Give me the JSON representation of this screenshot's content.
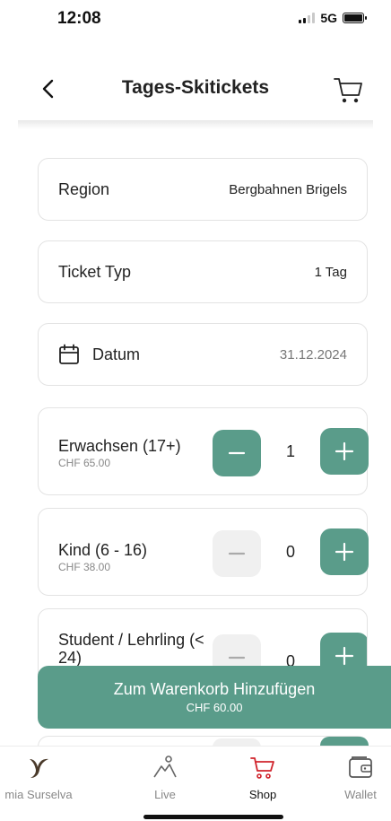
{
  "status_bar": {
    "time": "12:08",
    "network": "5G"
  },
  "header": {
    "title": "Tages-Skitickets"
  },
  "fields": {
    "region": {
      "label": "Region",
      "value": "Bergbahnen Brigels"
    },
    "ticket_type": {
      "label": "Ticket Typ",
      "value": "1 Tag"
    },
    "date": {
      "label": "Datum",
      "value": "31.12.2024"
    }
  },
  "categories": [
    {
      "name": "Erwachsen (17+)",
      "price": "CHF 65.00",
      "quantity": "1",
      "minus_enabled": true
    },
    {
      "name": "Kind (6 - 16)",
      "price": "CHF 38.00",
      "quantity": "0",
      "minus_enabled": false
    },
    {
      "name": "Student / Lehrling (< 24)",
      "price": "",
      "quantity": "0",
      "minus_enabled": false
    }
  ],
  "cart_button": {
    "label": "Zum Warenkorb Hinzufügen",
    "total": "CHF 60.00"
  },
  "tabs": [
    {
      "label": "mia Surselva",
      "icon": "mia-surselva-logo-icon",
      "active": false
    },
    {
      "label": "Live",
      "icon": "mountain-pin-icon",
      "active": false
    },
    {
      "label": "Shop",
      "icon": "shopping-cart-icon",
      "active": true
    },
    {
      "label": "Wallet",
      "icon": "wallet-icon",
      "active": false
    }
  ],
  "colors": {
    "accent": "#5a9c8a",
    "active_tab": "#d0242c",
    "disabled_button": "#f0f0f0"
  }
}
